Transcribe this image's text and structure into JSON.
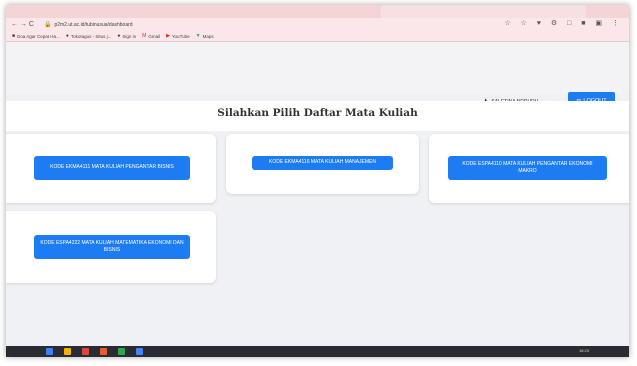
{
  "browser": {
    "url": "p2m2.ut.ac.id/tubinusua/dashboard",
    "nav_glyphs": "← → C",
    "right_glyphs": "☆ ☆ ♥ ⚙ □ ■ ▣ ⋮",
    "bookmarks": [
      {
        "icon": "■",
        "label": "Doa Agar Cepat Ha..."
      },
      {
        "icon": "●",
        "label": "Tokotagus - Situs j..."
      },
      {
        "icon": "●",
        "label": "Sign in"
      },
      {
        "icon": "M",
        "label": "Gmail"
      },
      {
        "icon": "▶",
        "label": "YouTube"
      },
      {
        "icon": "▼",
        "label": "Maps"
      }
    ]
  },
  "header": {
    "user_icon": "♟",
    "user_name": "SALETINA NDRURU",
    "logout_icon": "⇦",
    "logout_label": "LOGOUT"
  },
  "main": {
    "title": "Silahkan Pilih Daftar Mata Kuliah",
    "courses": [
      {
        "label": "KODE EKMA4111 MATA KULIAH PENGANTAR BISNIS"
      },
      {
        "label": "KODE EKMA4116 MATA KULIAH MANAJEMEN"
      },
      {
        "label": "KODE ESPA4110 MATA KULIAH PENGANTAR EKONOMI MAKRO"
      },
      {
        "label": "KODE ESPA4222 MATA KULIAH MATEMATIKA EKONOMI DAN BISNIS"
      }
    ]
  },
  "taskbar": {
    "clock": "16:23"
  },
  "colors": {
    "accent": "#1e7cf2",
    "browser_chrome": "#fbe7e9",
    "page_bg": "#f0f1f4"
  }
}
